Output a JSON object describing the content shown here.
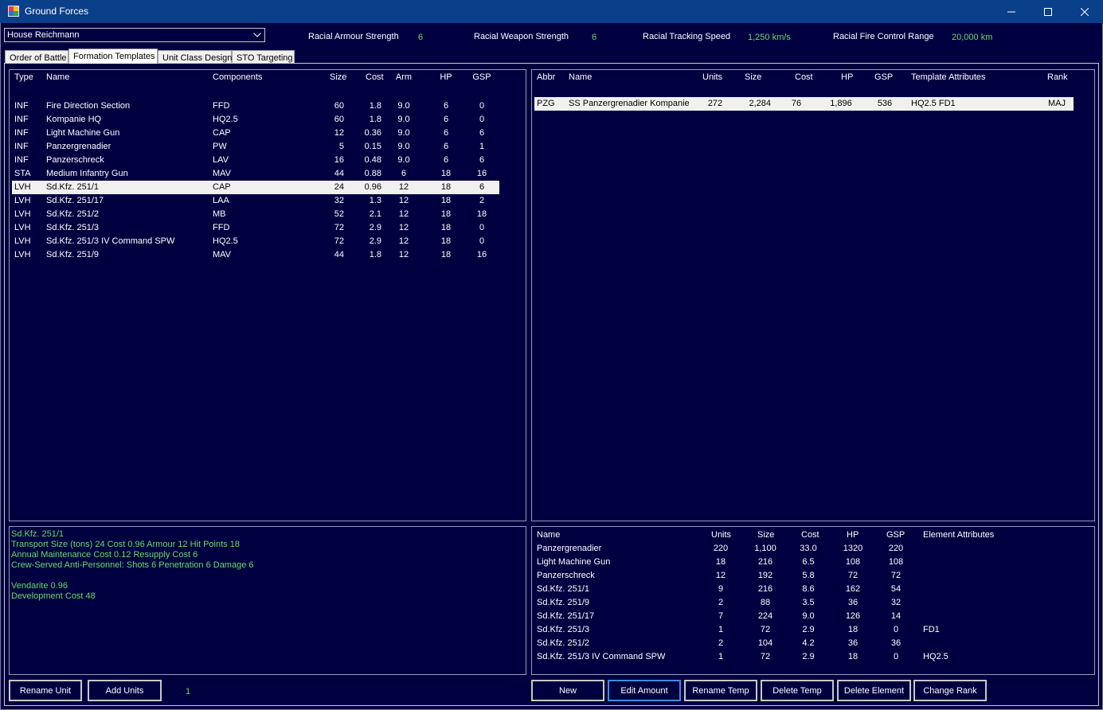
{
  "window": {
    "title": "Ground Forces"
  },
  "race_select": {
    "value": "House Reichmann"
  },
  "racial_stats": [
    {
      "label": "Racial Armour Strength",
      "value": "6"
    },
    {
      "label": "Racial Weapon Strength",
      "value": "6"
    },
    {
      "label": "Racial Tracking Speed",
      "value": "1,250 km/s"
    },
    {
      "label": "Racial Fire Control Range",
      "value": "20,000 km"
    }
  ],
  "tabs": [
    "Order of Battle",
    "Formation Templates",
    "Unit Class Design",
    "STO Targeting"
  ],
  "unit_classes": {
    "headers": [
      "Type",
      "Name",
      "Components",
      "Size",
      "Cost",
      "Arm",
      "HP",
      "GSP"
    ],
    "rows": [
      [
        "INF",
        "Fire Direction Section",
        "FFD",
        "60",
        "1.8",
        "9.0",
        "6",
        "0"
      ],
      [
        "INF",
        "Kompanie HQ",
        "HQ2.5",
        "60",
        "1.8",
        "9.0",
        "6",
        "0"
      ],
      [
        "INF",
        "Light Machine Gun",
        "CAP",
        "12",
        "0.36",
        "9.0",
        "6",
        "6"
      ],
      [
        "INF",
        "Panzergrenadier",
        "PW",
        "5",
        "0.15",
        "9.0",
        "6",
        "1"
      ],
      [
        "INF",
        "Panzerschreck",
        "LAV",
        "16",
        "0.48",
        "9.0",
        "6",
        "6"
      ],
      [
        "STA",
        "Medium Infantry Gun",
        "MAV",
        "44",
        "0.88",
        "6",
        "18",
        "16"
      ],
      [
        "LVH",
        "Sd.Kfz. 251/1",
        "CAP",
        "24",
        "0.96",
        "12",
        "18",
        "6"
      ],
      [
        "LVH",
        "Sd.Kfz. 251/17",
        "LAA",
        "32",
        "1.3",
        "12",
        "18",
        "2"
      ],
      [
        "LVH",
        "Sd.Kfz. 251/2",
        "MB",
        "52",
        "2.1",
        "12",
        "18",
        "18"
      ],
      [
        "LVH",
        "Sd.Kfz. 251/3",
        "FFD",
        "72",
        "2.9",
        "12",
        "18",
        "0"
      ],
      [
        "LVH",
        "Sd.Kfz. 251/3 IV Command SPW",
        "HQ2.5",
        "72",
        "2.9",
        "12",
        "18",
        "0"
      ],
      [
        "LVH",
        "Sd.Kfz. 251/9",
        "MAV",
        "44",
        "1.8",
        "12",
        "18",
        "16"
      ]
    ],
    "selected_index": 6
  },
  "templates": {
    "headers": [
      "Abbr",
      "Name",
      "Units",
      "Size",
      "Cost",
      "HP",
      "GSP",
      "Template Attributes",
      "Rank"
    ],
    "rows": [
      [
        "PZG",
        "SS Panzergrenadier Kompanie",
        "272",
        "2,284",
        "76",
        "1,896",
        "536",
        "HQ2.5  FD1",
        "MAJ"
      ]
    ],
    "selected_index": 0
  },
  "unit_info": [
    "Sd.Kfz. 251/1",
    "Transport Size (tons)  24     Cost  0.96     Armour  12     Hit Points  18",
    "Annual Maintenance Cost  0.12     Resupply Cost  6",
    "Crew-Served Anti-Personnel:      Shots 6       Penetration 6       Damage 6",
    "",
    "Vendarite  0.96",
    "Development Cost  48"
  ],
  "elements": {
    "headers": [
      "Name",
      "Units",
      "Size",
      "Cost",
      "HP",
      "GSP",
      "Element Attributes"
    ],
    "rows": [
      [
        "Panzergrenadier",
        "220",
        "1,100",
        "33.0",
        "1320",
        "220",
        ""
      ],
      [
        "Light Machine Gun",
        "18",
        "216",
        "6.5",
        "108",
        "108",
        ""
      ],
      [
        "Panzerschreck",
        "12",
        "192",
        "5.8",
        "72",
        "72",
        ""
      ],
      [
        "Sd.Kfz. 251/1",
        "9",
        "216",
        "8.6",
        "162",
        "54",
        ""
      ],
      [
        "Sd.Kfz. 251/9",
        "2",
        "88",
        "3.5",
        "36",
        "32",
        ""
      ],
      [
        "Sd.Kfz. 251/17",
        "7",
        "224",
        "9.0",
        "126",
        "14",
        ""
      ],
      [
        "Sd.Kfz. 251/3",
        "1",
        "72",
        "2.9",
        "18",
        "0",
        "FD1"
      ],
      [
        "Sd.Kfz. 251/2",
        "2",
        "104",
        "4.2",
        "36",
        "36",
        ""
      ],
      [
        "Sd.Kfz. 251/3 IV Command SPW",
        "1",
        "72",
        "2.9",
        "18",
        "0",
        "HQ2.5"
      ]
    ]
  },
  "left_buttons": {
    "rename_unit": "Rename Unit",
    "add_units": "Add Units",
    "units_amount": "1"
  },
  "right_buttons": [
    "New",
    "Edit Amount",
    "Rename Temp",
    "Delete Temp",
    "Delete Element",
    "Change Rank"
  ]
}
